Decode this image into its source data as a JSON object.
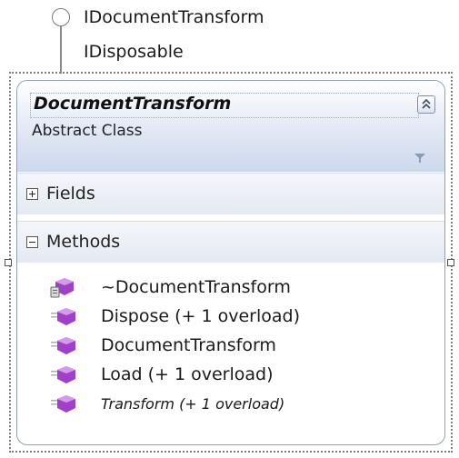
{
  "interfaces": [
    "IDocumentTransform",
    "IDisposable"
  ],
  "class_shape": {
    "name": "DocumentTransform",
    "kind": "Abstract Class",
    "collapse_icon": "double-chevron-up-icon",
    "filter_icon": "funnel-icon"
  },
  "compartments": {
    "fields": {
      "label": "Fields",
      "state": "collapsed"
    },
    "methods": {
      "label": "Methods",
      "state": "expanded"
    }
  },
  "methods": [
    {
      "label": "~DocumentTransform",
      "icon": "protected-method-icon",
      "abstract": false
    },
    {
      "label": "Dispose (+ 1 overload)",
      "icon": "public-method-icon",
      "abstract": false
    },
    {
      "label": "DocumentTransform",
      "icon": "public-method-icon",
      "abstract": false
    },
    {
      "label": "Load (+ 1 overload)",
      "icon": "public-method-icon",
      "abstract": false
    },
    {
      "label": "Transform (+ 1 overload)",
      "icon": "public-method-icon",
      "abstract": true
    }
  ],
  "colors": {
    "method_icon": "#a040c8",
    "header_gradient_end": "#ccd8ec",
    "border": "#8e9fb8"
  }
}
